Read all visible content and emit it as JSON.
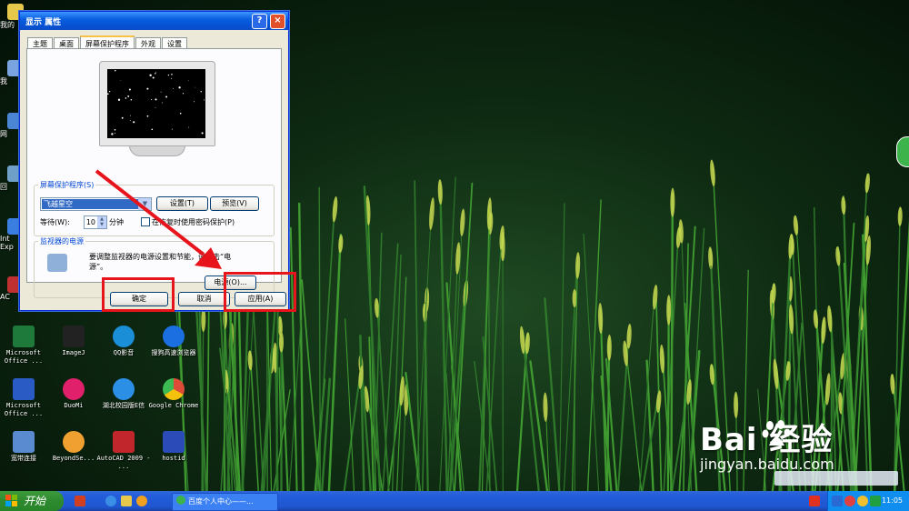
{
  "dialog": {
    "title": "显示 属性",
    "help_label": "?",
    "close_label": "×",
    "tabs": [
      "主题",
      "桌面",
      "屏幕保护程序",
      "外观",
      "设置"
    ],
    "active_tab": 2,
    "screensaver": {
      "legend": "屏幕保护程序(S)",
      "selected": "飞越星空",
      "settings_button": "设置(T)",
      "preview_button": "预览(V)",
      "wait_label": "等待(W):",
      "wait_value": "10",
      "minutes_label": "分钟",
      "password_label": "在恢复时使用密码保护(P)",
      "password_checked": false
    },
    "power": {
      "legend": "监视器的电源",
      "description_1": "要调整监视器的电源设置和节能，请单击“电",
      "description_2": "源”。",
      "power_button": "电源(O)..."
    },
    "ok_button": "确定",
    "cancel_button": "取消",
    "apply_button": "应用(A)"
  },
  "desktop": {
    "partial_left": [
      "我的",
      "我",
      "网",
      "回",
      "Int Exp",
      "AC"
    ],
    "icons": [
      {
        "name": "ms-office-excel",
        "label": "Microsoft Office ...",
        "color": "#1e7a3a"
      },
      {
        "name": "imagej",
        "label": "ImageJ",
        "color": "#222222"
      },
      {
        "name": "qqyingyin",
        "label": "QQ影音",
        "color": "#1a8fd8"
      },
      {
        "name": "sogou-browser",
        "label": "搜狗高速浏览器",
        "color": "#1b6fe0"
      },
      {
        "name": "ms-office-word",
        "label": "Microsoft Office ...",
        "color": "#2a5bc4"
      },
      {
        "name": "duomi",
        "label": "DuoMi",
        "color": "#e0206a"
      },
      {
        "name": "hubei-campus",
        "label": "湖北校园版E信",
        "color": "#2b8fe6"
      },
      {
        "name": "google-chrome",
        "label": "Google Chrome",
        "color": "#dd4b39"
      },
      {
        "name": "broadband",
        "label": "宽带连接",
        "color": "#5a8ad0"
      },
      {
        "name": "beyondsee",
        "label": "BeyondSe...",
        "color": "#f0a030"
      },
      {
        "name": "autocad",
        "label": "AutoCAD 2009 - ...",
        "color": "#c0262c"
      },
      {
        "name": "hostid",
        "label": "hostid",
        "color": "#2b4cb8"
      }
    ]
  },
  "taskbar": {
    "start_label": "开始",
    "task_label": "百度个人中心——...",
    "clock": "11:05"
  },
  "watermark": {
    "main": "Bai  经验",
    "url": "jingyan.baidu.com"
  },
  "colors": {
    "title_blue": "#0a5fe0",
    "highlight_red": "#e8141b",
    "start_green": "#2f8a2f",
    "taskbar_blue": "#245edb"
  }
}
